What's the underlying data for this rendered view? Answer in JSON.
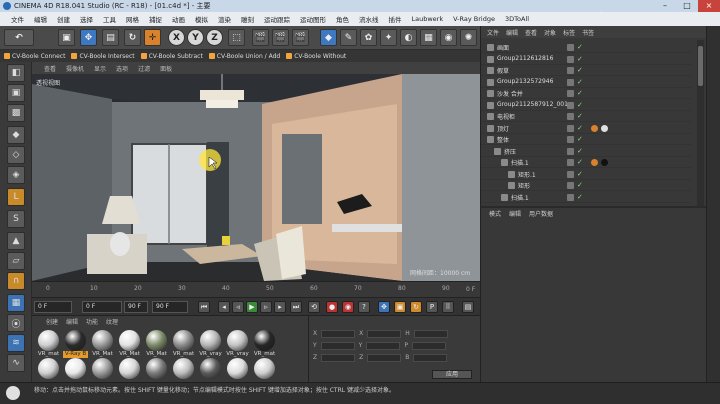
{
  "window": {
    "title": "CINEMA 4D R18.041 Studio (RC - R18) - [01.c4d *] - 主要",
    "controls": [
      "–",
      "□",
      "×"
    ]
  },
  "watermark": "虎课网",
  "menubar": [
    "文件",
    "编辑",
    "创建",
    "选择",
    "工具",
    "网格",
    "捕捉",
    "动画",
    "模拟",
    "渲染",
    "雕刻",
    "运动跟踪",
    "运动图形",
    "角色",
    "流水线",
    "插件",
    "Laubwerk",
    "V-Ray Bridge",
    "3DToAll"
  ],
  "toolbar": {
    "letters": [
      "X",
      "Y",
      "Z"
    ]
  },
  "boole_tabs": [
    "CV-Boole Connect",
    "CV-Boole Intersect",
    "CV-Boole Subtract",
    "CV-Boole Union / Add",
    "CV-Boole Without"
  ],
  "viewport": {
    "menu": [
      "查看",
      "摄像机",
      "显示",
      "选项",
      "过滤",
      "面板"
    ],
    "label": "透视视图",
    "grid_label": "网格间距：10000 cm",
    "colors": {
      "wall": "#6f7478",
      "ceiling": "#2d3136",
      "floor": "#2b2c2e",
      "door": "#d9b79a"
    }
  },
  "timeline": {
    "ticks": [
      "0",
      "10",
      "20",
      "30",
      "40",
      "50",
      "60",
      "70",
      "80",
      "90"
    ],
    "end_label": "0 F"
  },
  "playback": {
    "start_field": "0 F",
    "range_start": "0 F",
    "range_end": "90 F",
    "end_field": "90 F"
  },
  "material_panel": {
    "menu": [
      "创建",
      "编辑",
      "功能",
      "纹理"
    ],
    "materials": [
      {
        "label": "VR_mat",
        "color": "#cfcfcf"
      },
      {
        "label": "V-Ray B",
        "color": "#2b2b2b",
        "selected": true
      },
      {
        "label": "VR_Mat",
        "color": "#9a9a9a"
      },
      {
        "label": "VR_Mat",
        "color": "#e2e2e2"
      },
      {
        "label": "VR_Mat",
        "color": "#7d8a6a"
      },
      {
        "label": "VR_mat",
        "color": "#8c8c8c"
      },
      {
        "label": "VR_vray",
        "color": "#b5b5b5"
      },
      {
        "label": "VR_vray",
        "color": "#c4c4c4"
      },
      {
        "label": "VR_mat",
        "color": "#262626"
      },
      {
        "label": "",
        "color": "#d0d0d0"
      },
      {
        "label": "",
        "color": "#e8e8e8"
      },
      {
        "label": "",
        "color": "#9b9b9b"
      },
      {
        "label": "",
        "color": "#d6d6d6"
      },
      {
        "label": "",
        "color": "#7b7b7b"
      },
      {
        "label": "",
        "color": "#bdbdbd"
      },
      {
        "label": "",
        "color": "#5a5a5a"
      },
      {
        "label": "",
        "color": "#dcdcdc"
      },
      {
        "label": "",
        "color": "#cfcfcf"
      }
    ]
  },
  "coord_panel": {
    "rows": [
      [
        "X",
        "0 cm",
        "X",
        "0 cm",
        "H",
        "0 °"
      ],
      [
        "Y",
        "0 cm",
        "Y",
        "0 cm",
        "P",
        "0 °"
      ],
      [
        "Z",
        "0 cm",
        "Z",
        "0 cm",
        "B",
        "0 °"
      ]
    ],
    "dropdown_1": "世界坐标",
    "dropdown_2": "缩放比例",
    "apply": "应用"
  },
  "object_panel": {
    "menu": [
      "文件",
      "编辑",
      "查看",
      "对象",
      "标签",
      "书签"
    ],
    "rows": [
      {
        "name": "画面",
        "indent": 0
      },
      {
        "name": "Group2112612816",
        "indent": 0
      },
      {
        "name": "假草",
        "indent": 0
      },
      {
        "name": "Group2132572946",
        "indent": 0
      },
      {
        "name": "沙发 合并",
        "indent": 0
      },
      {
        "name": "Group2112587912_001",
        "indent": 0
      },
      {
        "name": "电视柜",
        "indent": 0
      },
      {
        "name": "顶灯",
        "indent": 0,
        "tags": [
          "#d9822b",
          "#e0e0e0"
        ]
      },
      {
        "name": "整体",
        "indent": 0
      },
      {
        "name": "挤压",
        "indent": 1
      },
      {
        "name": "扫描.1",
        "indent": 2,
        "tags": [
          "#d9822b",
          "#111111"
        ]
      },
      {
        "name": "矩形.1",
        "indent": 3
      },
      {
        "name": "矩形",
        "indent": 3
      },
      {
        "name": "扫描.1",
        "indent": 2
      }
    ]
  },
  "attr_panel": {
    "menu": [
      "模式",
      "编辑",
      "用户数据"
    ]
  },
  "status": "移动：点击并拖动鼠标移动元素。按住 SHIFT 键量化移动；节点编辑模式时按住 SHIFT 键增加选择对象；按住 CTRL 键减少选择对象。"
}
